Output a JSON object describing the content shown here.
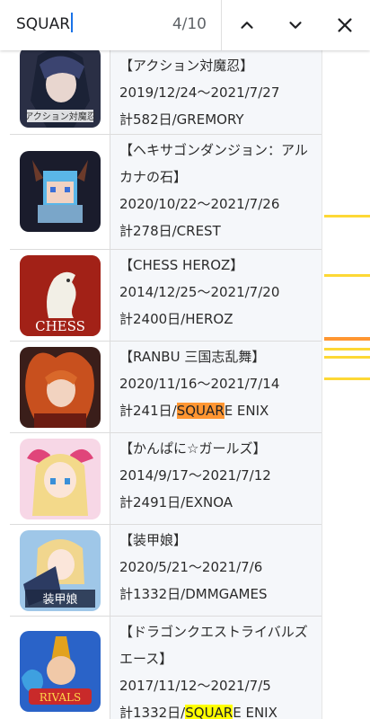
{
  "find_bar": {
    "query": "SQUAR",
    "match_count": "4/10",
    "prev_icon": "chevron-up-icon",
    "next_icon": "chevron-down-icon",
    "close_icon": "close-icon"
  },
  "items": [
    {
      "title": "【アクション対魔忍】",
      "period": "2019/12/24〜2021/7/27",
      "days": "計582日/GREMORY",
      "icon": "taimanin-app-icon"
    },
    {
      "title": "【ヘキサゴンダンジョン：アルカナの石】",
      "period": "2020/10/22〜2021/7/26",
      "days": "計278日/CREST",
      "icon": "hexagon-dungeon-app-icon"
    },
    {
      "title": "【CHESS HEROZ】",
      "period": "2014/12/25〜2021/7/20",
      "days": "計2400日/HEROZ",
      "icon": "chess-app-icon",
      "icon_text": "CHESS"
    },
    {
      "title": "【RANBU 三国志乱舞】",
      "period": "2020/11/16〜2021/7/14",
      "days_prefix": "計241日/",
      "days_match": "SQUAR",
      "days_suffix": "E ENIX",
      "icon": "ranbu-app-icon"
    },
    {
      "title": "【かんぱに☆ガールズ】",
      "period": "2014/9/17〜2021/7/12",
      "days": "計2491日/EXNOA",
      "icon": "kanpani-app-icon"
    },
    {
      "title": "【装甲娘】",
      "period": "2020/5/21〜2021/7/6",
      "days": "計1332日/DMMGAMES",
      "icon": "soukou-musume-app-icon",
      "icon_text": "装甲娘"
    },
    {
      "title": "【ドラゴンクエストライバルズ エース】",
      "period": "2017/11/12〜2021/7/5",
      "days_prefix": "計1332日/",
      "days_match": "SQUAR",
      "days_suffix": "E ENIX",
      "icon": "dq-rivals-app-icon",
      "icon_text": "RIVALS"
    }
  ],
  "colors": {
    "active_match": "#ff9632",
    "other_match": "#ffff00",
    "accent": "#1a73e8"
  }
}
